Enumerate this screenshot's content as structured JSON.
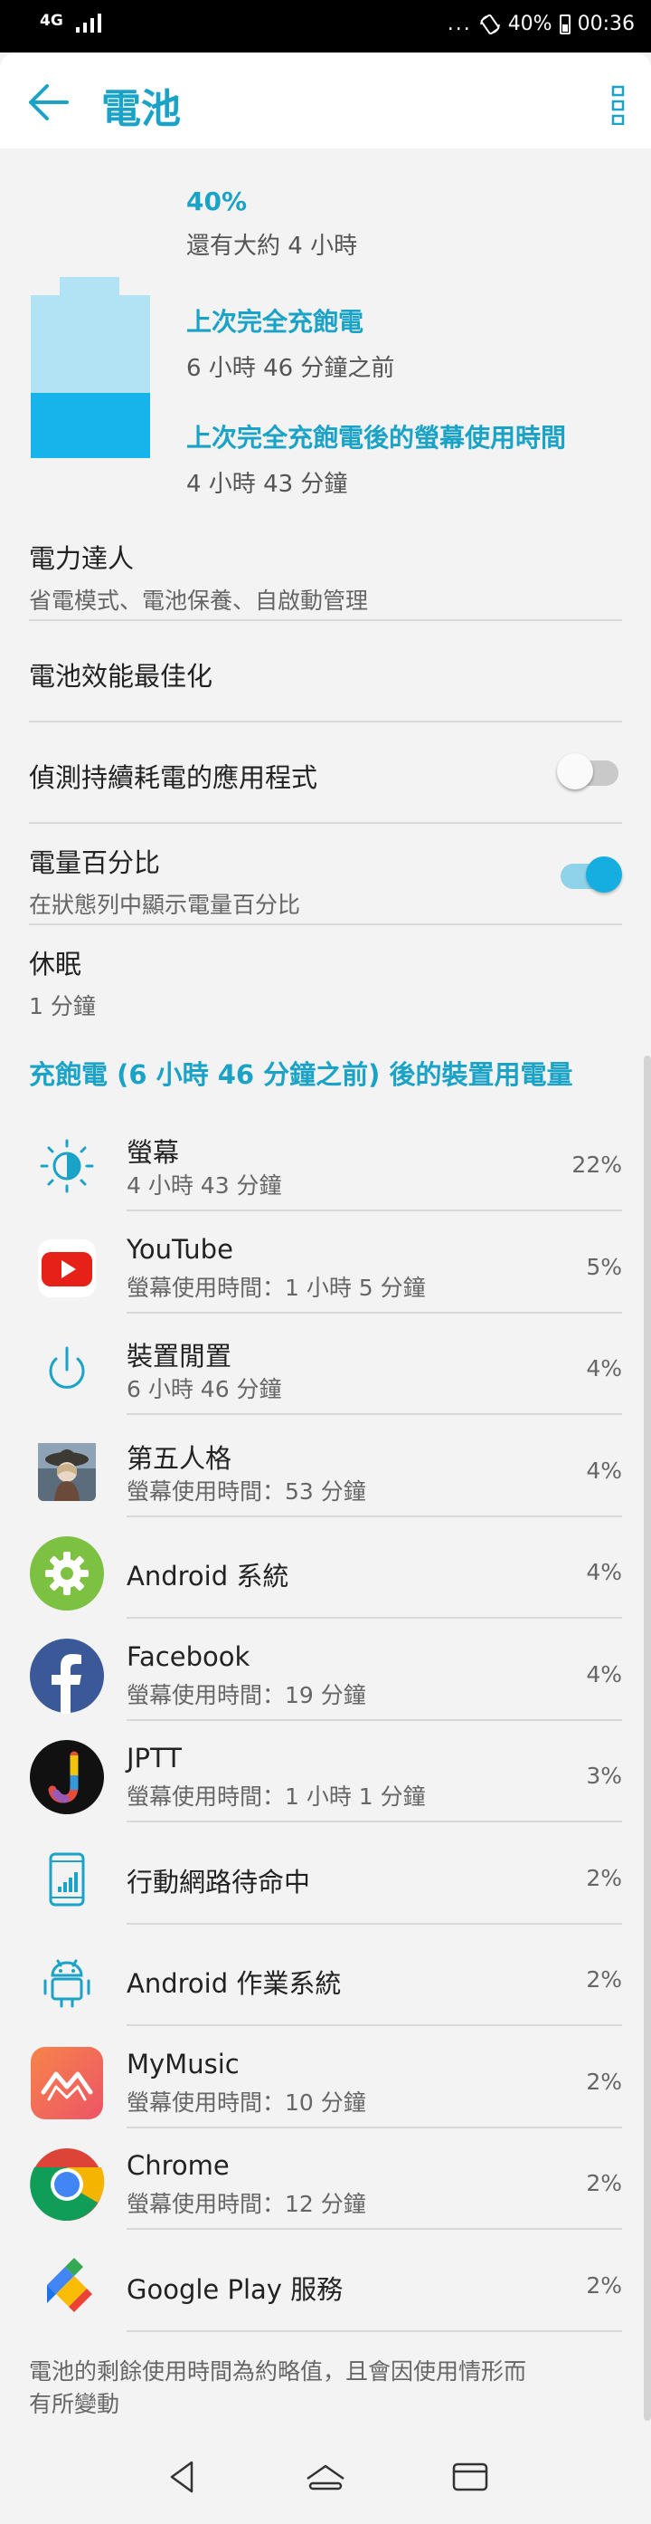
{
  "status_bar": {
    "network": "4G",
    "dots": "...",
    "battery": "40%",
    "time": "00:36"
  },
  "app_bar": {
    "title": "電池",
    "back_icon": "arrow-left-icon",
    "more_icon": "more-vert-icon"
  },
  "summary": {
    "percent": "40%",
    "remaining": "還有大約 4 小時",
    "last_full_label": "上次完全充飽電",
    "last_full_value": "6 小時 46 分鐘之前",
    "screen_usage_label": "上次完全充飽電後的螢幕使用時間",
    "screen_usage_value": "4 小時 43 分鐘",
    "battery_level": 0.4
  },
  "settings": {
    "power_master": {
      "title": "電力達人",
      "subtitle": "省電模式、電池保養、自啟動管理"
    },
    "optimize": {
      "title": "電池效能最佳化"
    },
    "detect_drain": {
      "title": "偵測持續耗電的應用程式",
      "enabled": false
    },
    "battery_percent": {
      "title": "電量百分比",
      "subtitle": "在狀態列中顯示電量百分比",
      "enabled": true
    },
    "sleep": {
      "title": "休眠",
      "value": "1 分鐘"
    }
  },
  "usage": {
    "header": "充飽電 (6 小時 46 分鐘之前) 後的裝置用電量",
    "items": [
      {
        "name": "螢幕",
        "detail": "4 小時 43 分鐘",
        "percent": "22%",
        "icon": "brightness-icon"
      },
      {
        "name": "YouTube",
        "detail": "螢幕使用時間：1 小時 5 分鐘",
        "percent": "5%",
        "icon": "youtube-icon"
      },
      {
        "name": "裝置閒置",
        "detail": "6 小時 46 分鐘",
        "percent": "4%",
        "icon": "power-icon"
      },
      {
        "name": "第五人格",
        "detail": "螢幕使用時間：53 分鐘",
        "percent": "4%",
        "icon": "identity-v-game-icon"
      },
      {
        "name": "Android 系統",
        "detail": "",
        "percent": "4%",
        "icon": "android-system-gear-icon"
      },
      {
        "name": "Facebook",
        "detail": "螢幕使用時間：19 分鐘",
        "percent": "4%",
        "icon": "facebook-icon"
      },
      {
        "name": "JPTT",
        "detail": "螢幕使用時間：1 小時 1 分鐘",
        "percent": "3%",
        "icon": "jptt-icon"
      },
      {
        "name": "行動網路待命中",
        "detail": "",
        "percent": "2%",
        "icon": "cell-standby-icon"
      },
      {
        "name": "Android 作業系統",
        "detail": "",
        "percent": "2%",
        "icon": "android-robot-icon"
      },
      {
        "name": "MyMusic",
        "detail": "螢幕使用時間：10 分鐘",
        "percent": "2%",
        "icon": "mymusic-icon"
      },
      {
        "name": "Chrome",
        "detail": "螢幕使用時間：12 分鐘",
        "percent": "2%",
        "icon": "chrome-icon"
      },
      {
        "name": "Google Play 服務",
        "detail": "",
        "percent": "2%",
        "icon": "google-play-services-icon"
      }
    ]
  },
  "footer_note": "電池的剩餘使用時間為約略值，且會因使用情形而有所變動",
  "colors": {
    "accent": "#1aa3c7",
    "battery_light": "#b2e3f4",
    "battery_fill": "#16b4ea"
  },
  "nav_bar": {
    "back_icon": "nav-back-icon",
    "home_icon": "nav-home-icon",
    "recents_icon": "nav-recents-icon"
  }
}
